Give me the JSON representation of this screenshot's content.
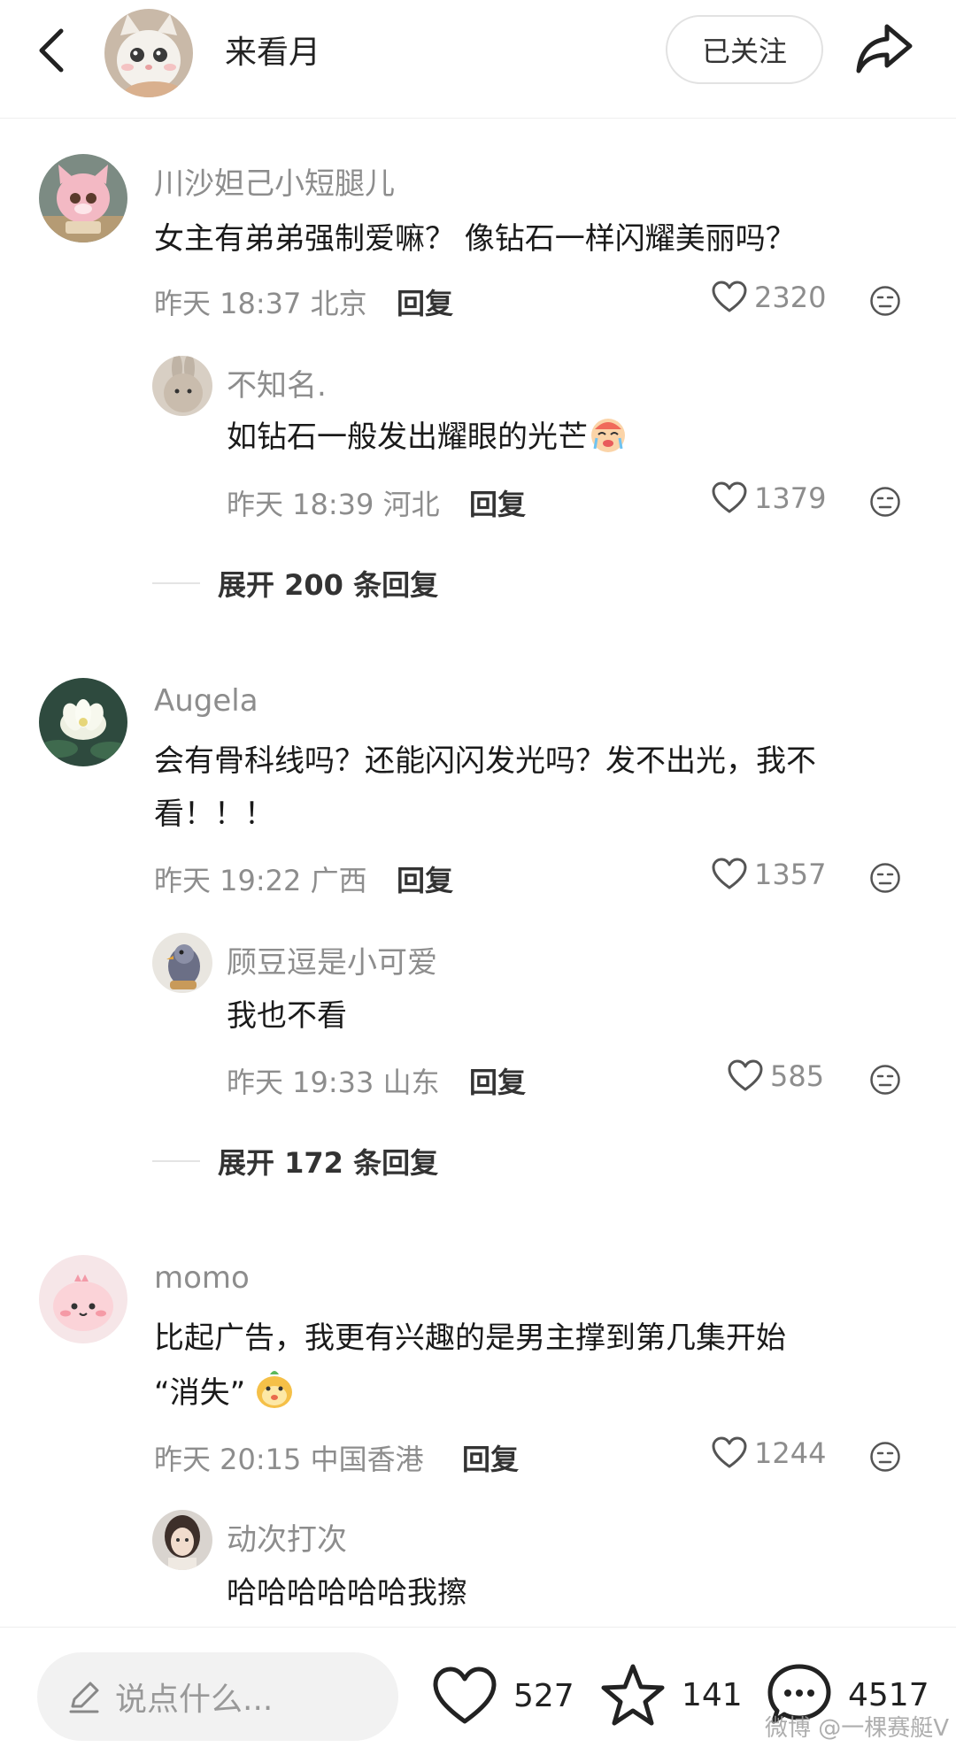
{
  "header": {
    "title": "来看月",
    "follow_label": "已关注"
  },
  "comments": [
    {
      "name": "川沙妲己小短腿儿",
      "content_lines": [
        "女主有弟弟强制爱嘛？ 像钻石一样闪耀美丽吗？"
      ],
      "time": "昨天 18:37 北京",
      "reply_label": "回复",
      "likes": "2320",
      "reply": {
        "name": "不知名.",
        "content": "如钻石一般发出耀眼的光芒",
        "emoji": "crying-face",
        "time": "昨天 18:39 河北",
        "reply_label": "回复",
        "likes": "1379"
      },
      "expand_label": "展开 200 条回复"
    },
    {
      "name": "Augela",
      "content_lines": [
        "会有骨科线吗？还能闪闪发光吗？发不出光，我不",
        "看！！！"
      ],
      "time": "昨天 19:22 广西",
      "reply_label": "回复",
      "likes": "1357",
      "reply": {
        "name": "顾豆逗是小可爱",
        "content": "我也不看",
        "time": "昨天 19:33 山东",
        "reply_label": "回复",
        "likes": "585"
      },
      "expand_label": "展开 172 条回复"
    },
    {
      "name": "momo",
      "content_lines": [
        "比起广告，我更有兴趣的是男主撑到第几集开始",
        "“消失”"
      ],
      "emoji": "bun-face",
      "time": "昨天 20:15 中国香港",
      "reply_label": "回复",
      "likes": "1244",
      "reply": {
        "name": "动次打次",
        "content": "哈哈哈哈哈哈我擦"
      }
    }
  ],
  "bottom_bar": {
    "input_placeholder": "说点什么...",
    "likes": "527",
    "stars": "141",
    "comments": "4517"
  },
  "watermark": "微博 @一棵赛艇V",
  "colors": {
    "muted": "#8d8d8d",
    "text": "#1a1a1a",
    "input_bg": "#f2f2f2"
  }
}
